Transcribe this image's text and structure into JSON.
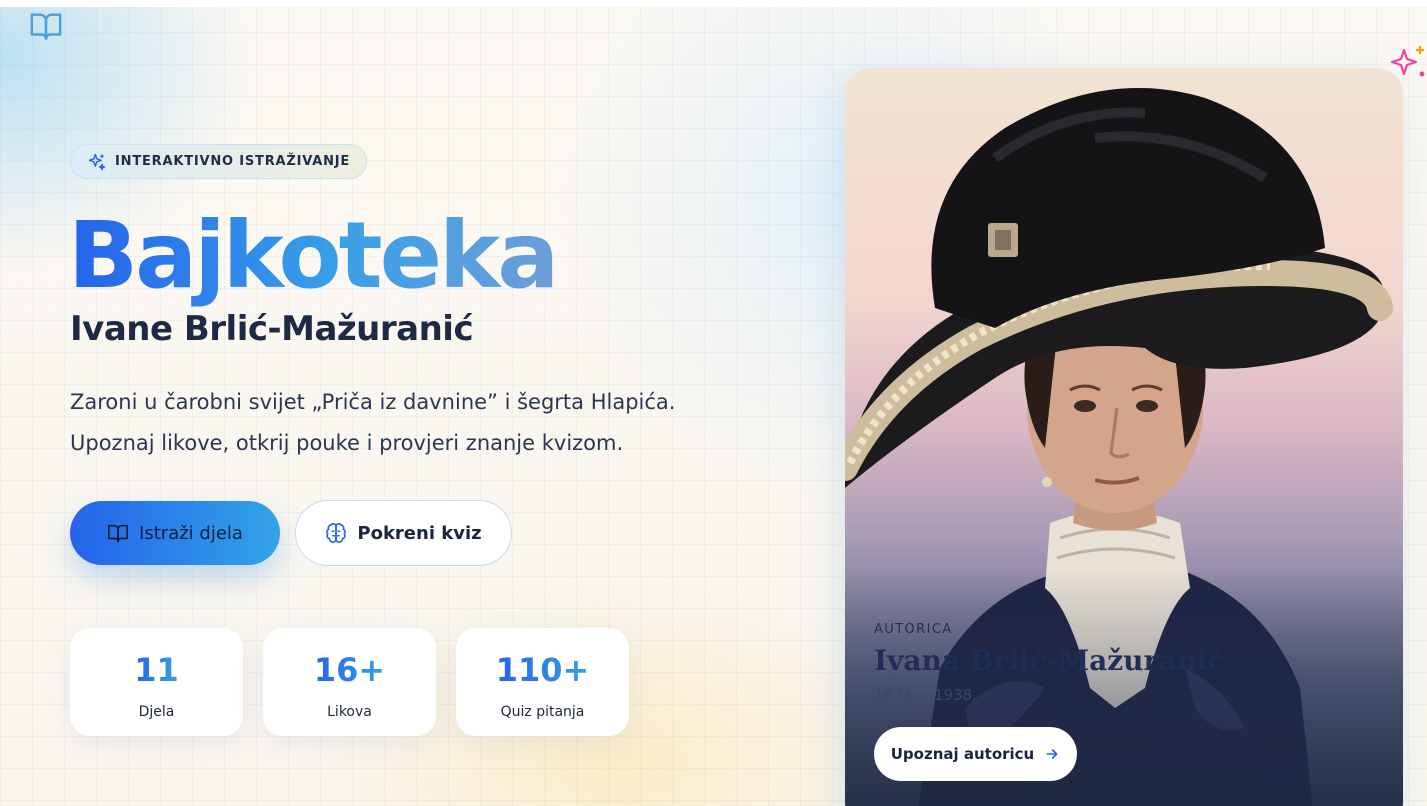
{
  "hero": {
    "badge_text": "INTERAKTIVNO ISTRAŽIVANJE",
    "title": "Bajkoteka",
    "subtitle": "Ivane Brlić-Mažuranić",
    "description_line1": "Zaroni u čarobni svijet „Priča iz davnine” i šegrta Hlapića.",
    "description_line2": "Upoznaj likove, otkrij pouke i provjeri znanje kvizom.",
    "primary_button": "Istraži djela",
    "secondary_button": "Pokreni kviz"
  },
  "stats": [
    {
      "value": "11",
      "label": "Djela"
    },
    {
      "value": "16+",
      "label": "Likova"
    },
    {
      "value": "110+",
      "label": "Quiz pitanja"
    }
  ],
  "author_card": {
    "eyebrow": "AUTORICA",
    "name": "Ivana Brlić-Mažuranić",
    "years": "1874. – 1938.",
    "button": "Upoznaj autoricu"
  },
  "icons": {
    "logo": "book-open-icon",
    "badge": "sparkles-icon",
    "primary_button": "book-open-icon",
    "secondary_button": "brain-icon",
    "card_button": "arrow-right-icon",
    "decoration": "sparkles-icon"
  },
  "colors": {
    "accent_blue": "#2563eb",
    "accent_sky": "#38a0e8",
    "text_dark": "#1e293b",
    "sparkle_pink": "#ec4899"
  }
}
